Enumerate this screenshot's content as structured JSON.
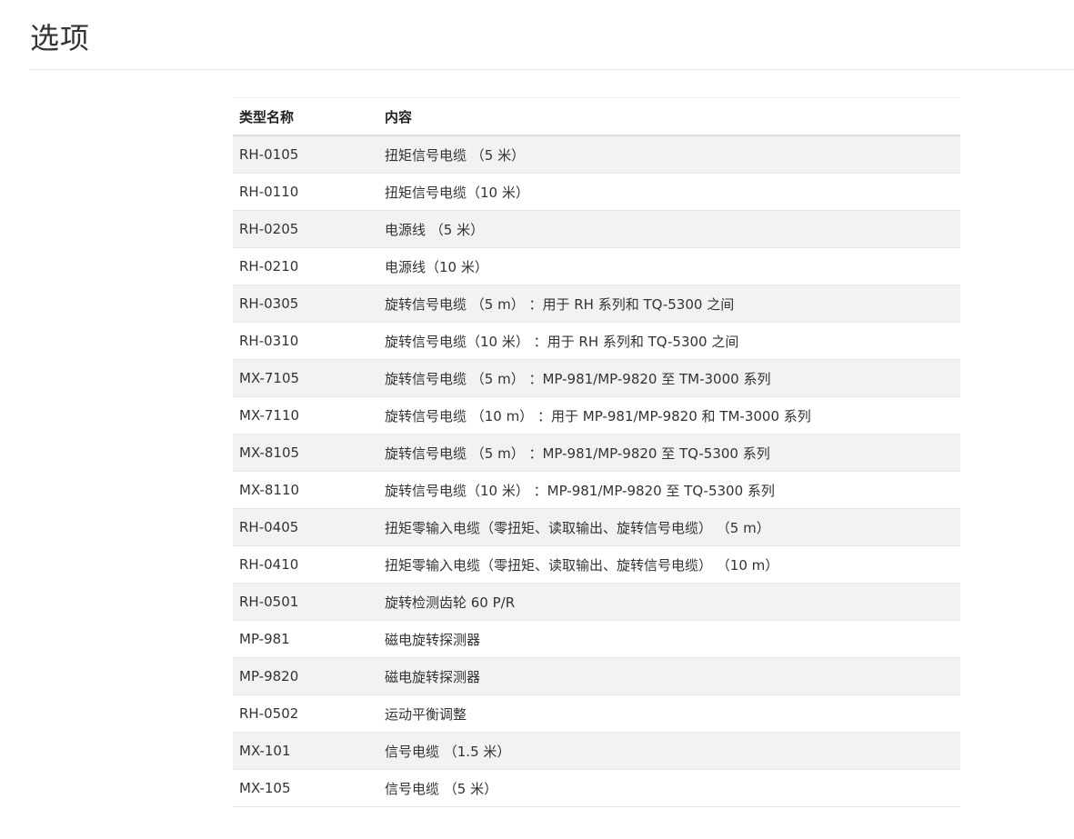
{
  "page": {
    "title": "选项"
  },
  "table": {
    "headers": [
      "类型名称",
      "内容"
    ],
    "rows": [
      [
        "RH-0105",
        "扭矩信号电缆 （5 米）"
      ],
      [
        "RH-0110",
        "扭矩信号电缆（10 米）"
      ],
      [
        "RH-0205",
        "电源线 （5 米）"
      ],
      [
        "RH-0210",
        "电源线（10 米）"
      ],
      [
        "RH-0305",
        "旋转信号电缆 （5 m） ：用于 RH 系列和 TQ-5300 之间"
      ],
      [
        "RH-0310",
        "旋转信号电缆（10 米） ：用于 RH 系列和 TQ-5300 之间"
      ],
      [
        "MX-7105",
        "旋转信号电缆 （5 m） ：MP-981/MP-9820 至 TM-3000 系列"
      ],
      [
        "MX-7110",
        "旋转信号电缆 （10 m） ：用于 MP-981/MP-9820 和 TM-3000 系列"
      ],
      [
        "MX-8105",
        "旋转信号电缆 （5 m） ：MP-981/MP-9820 至 TQ-5300 系列"
      ],
      [
        "MX-8110",
        "旋转信号电缆（10 米） ：MP-981/MP-9820 至 TQ-5300 系列"
      ],
      [
        "RH-0405",
        "扭矩零输入电缆（零扭矩、读取输出、旋转信号电缆） （5 m）"
      ],
      [
        "RH-0410",
        "扭矩零输入电缆（零扭矩、读取输出、旋转信号电缆） （10 m）"
      ],
      [
        "RH-0501",
        "旋转检测齿轮 60 P/R"
      ],
      [
        "MP-981",
        "磁电旋转探测器"
      ],
      [
        "MP-9820",
        "磁电旋转探测器"
      ],
      [
        "RH-0502",
        "运动平衡调整"
      ],
      [
        "MX-101",
        "信号电缆 （1.5 米）"
      ],
      [
        "MX-105",
        "信号电缆 （5 米）"
      ]
    ]
  }
}
